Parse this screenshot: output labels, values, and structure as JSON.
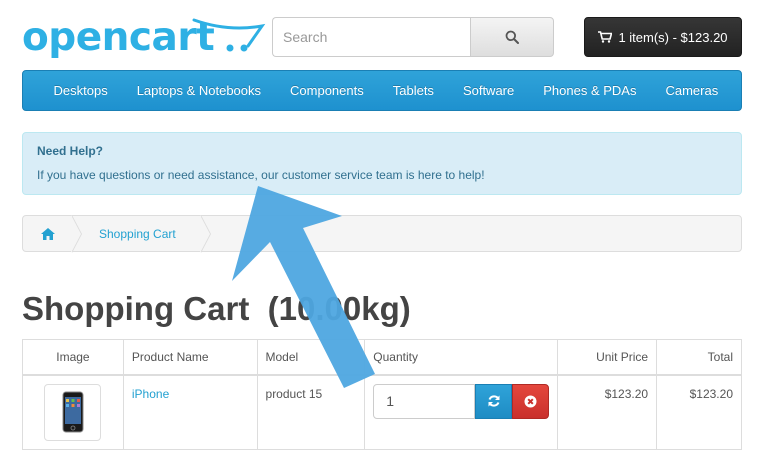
{
  "header": {
    "logo_text": "opencart",
    "search_placeholder": "Search",
    "cart_label": "1 item(s) - $123.20"
  },
  "menu": {
    "items": [
      "Desktops",
      "Laptops & Notebooks",
      "Components",
      "Tablets",
      "Software",
      "Phones & PDAs",
      "Cameras"
    ]
  },
  "help": {
    "title": "Need Help?",
    "text": "If you have questions or need assistance, our customer service team is here to help!"
  },
  "breadcrumb": {
    "current": "Shopping Cart"
  },
  "page": {
    "title": "Shopping Cart  (10.00kg)"
  },
  "cart_table": {
    "headers": [
      "Image",
      "Product Name",
      "Model",
      "Quantity",
      "Unit Price",
      "Total"
    ],
    "rows": [
      {
        "product": "iPhone",
        "model": "product 15",
        "quantity": "1",
        "unit_price": "$123.20",
        "total": "$123.20"
      }
    ]
  },
  "colors": {
    "brand_blue": "#23a1d1",
    "menu_bg": "#229ac8",
    "cart_button_bg": "#2b2b2b",
    "help_bg": "#d9edf7",
    "remove_red": "#d9534f",
    "annotation_arrow": "#4aa3df"
  }
}
